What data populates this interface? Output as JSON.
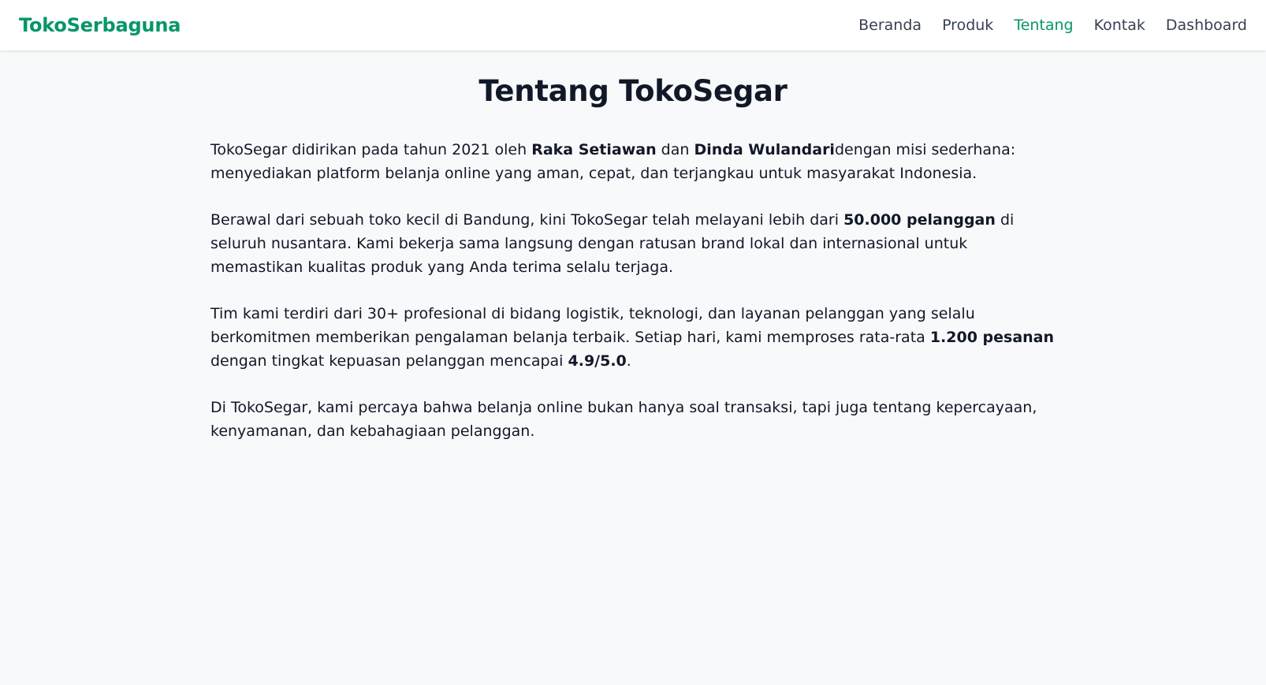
{
  "brand": "TokoSerbaguna",
  "nav": {
    "items": [
      {
        "label": "Beranda",
        "active": false
      },
      {
        "label": "Produk",
        "active": false
      },
      {
        "label": "Tentang",
        "active": true
      },
      {
        "label": "Kontak",
        "active": false
      },
      {
        "label": "Dashboard",
        "active": false
      }
    ]
  },
  "page": {
    "title": "Tentang TokoSegar"
  },
  "about": {
    "p1": {
      "t1": "TokoSegar didirikan pada tahun 2021 oleh ",
      "b1": "Raka Setiawan",
      "t2": " dan ",
      "b2": "Dinda Wulandari",
      "t3": "dengan misi sederhana: menyediakan platform belanja online yang aman, cepat, dan terjangkau untuk masyarakat Indonesia."
    },
    "p2": {
      "t1": "Berawal dari sebuah toko kecil di Bandung, kini TokoSegar telah melayani lebih dari ",
      "b1": "50.000 pelanggan",
      "t2": " di seluruh nusantara. Kami bekerja sama langsung dengan ratusan brand lokal dan internasional untuk memastikan kualitas produk yang Anda terima selalu terjaga."
    },
    "p3": {
      "t1": "Tim kami terdiri dari 30+ profesional di bidang logistik, teknologi, dan layanan pelanggan yang selalu berkomitmen memberikan pengalaman belanja terbaik. Setiap hari, kami memproses rata-rata ",
      "b1": "1.200 pesanan",
      "t2": " dengan tingkat kepuasan pelanggan mencapai ",
      "b2": "4.9/5.0",
      "t3": "."
    },
    "p4": {
      "t1": "Di TokoSegar, kami percaya bahwa belanja online bukan hanya soal transaksi, tapi juga tentang kepercayaan, kenyamanan, dan kebahagiaan pelanggan."
    }
  },
  "colors": {
    "accent": "#059669",
    "nav_text": "#374151",
    "background": "#f8f9fa",
    "text": "#111827"
  }
}
